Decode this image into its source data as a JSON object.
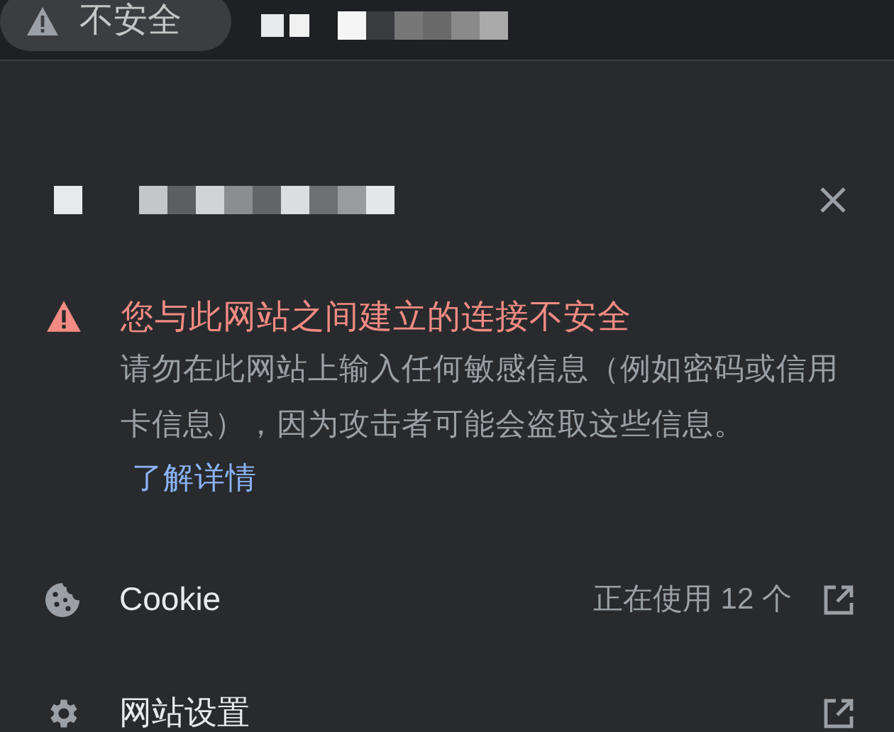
{
  "address_bar": {
    "security_chip": "不安全"
  },
  "warning": {
    "title": "您与此网站之间建立的连接不安全",
    "description": "请勿在此网站上输入任何敏感信息（例如密码或信用卡信息），因为攻击者可能会盗取这些信息。",
    "link": "了解详情"
  },
  "rows": [
    {
      "kind": "cookie",
      "label": "Cookie",
      "detail": "正在使用 12 个"
    },
    {
      "kind": "settings",
      "label": "网站设置"
    }
  ]
}
